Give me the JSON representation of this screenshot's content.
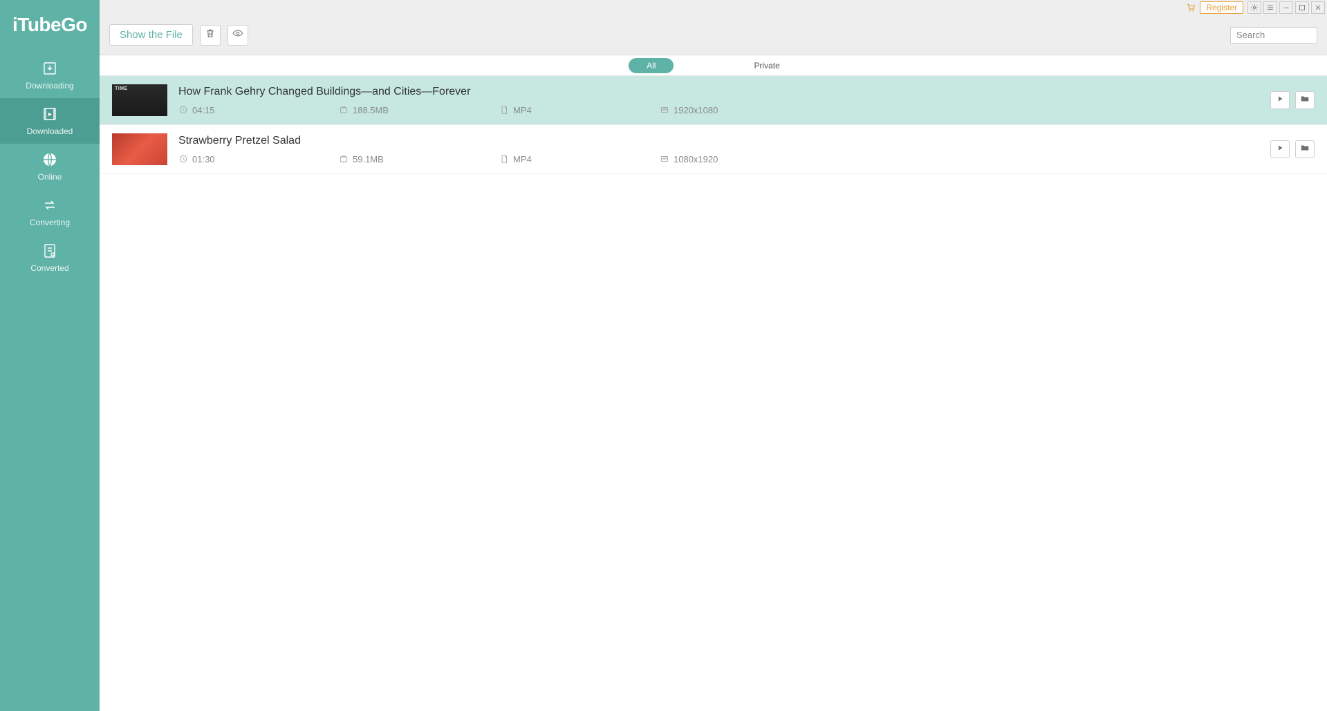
{
  "app": {
    "name": "iTubeGo"
  },
  "sidebar": {
    "items": [
      {
        "label": "Downloading",
        "active": false
      },
      {
        "label": "Downloaded",
        "active": true
      },
      {
        "label": "Online",
        "active": false
      },
      {
        "label": "Converting",
        "active": false
      },
      {
        "label": "Converted",
        "active": false
      }
    ]
  },
  "titlebar": {
    "register_label": "Register"
  },
  "toolbar": {
    "show_file_label": "Show the File",
    "search_placeholder": "Search"
  },
  "tabs": {
    "items": [
      {
        "label": "All",
        "active": true
      },
      {
        "label": "Private",
        "active": false
      }
    ]
  },
  "files": [
    {
      "title": "How Frank Gehry Changed Buildings—and Cities—Forever",
      "duration": "04:15",
      "size": "188.5MB",
      "format": "MP4",
      "resolution": "1920x1080",
      "selected": true,
      "thumb_style": "bw"
    },
    {
      "title": "Strawberry Pretzel Salad",
      "duration": "01:30",
      "size": "59.1MB",
      "format": "MP4",
      "resolution": "1080x1920",
      "selected": false,
      "thumb_style": "food"
    }
  ]
}
